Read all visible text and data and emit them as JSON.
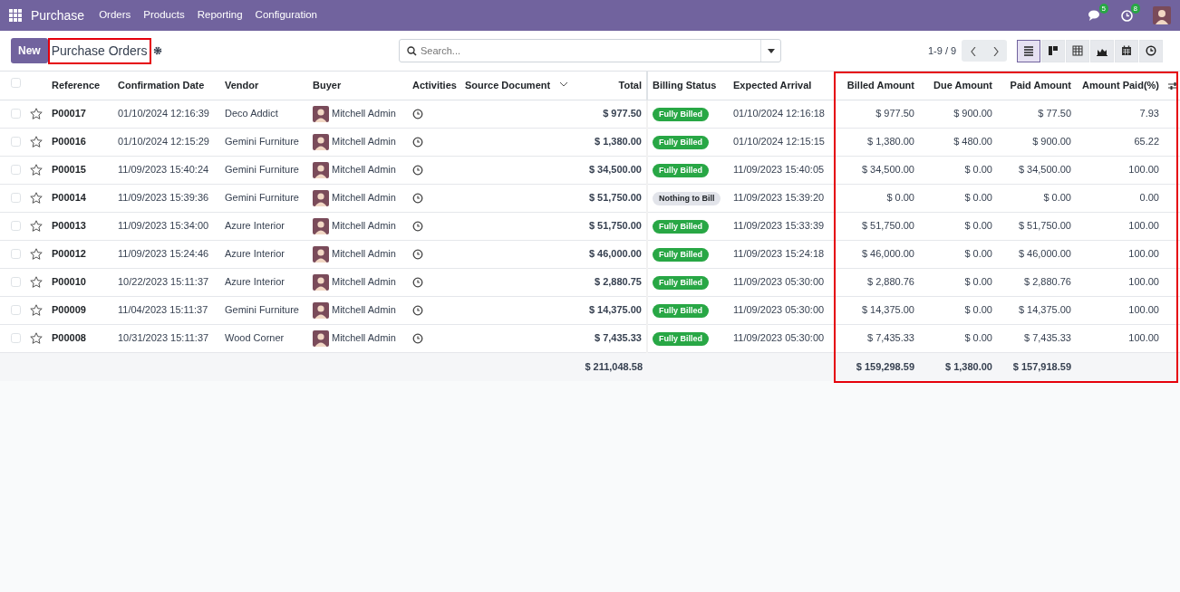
{
  "navbar": {
    "app": "Purchase",
    "menu": [
      "Orders",
      "Products",
      "Reporting",
      "Configuration"
    ],
    "messages_count": "5",
    "activities_count": "8"
  },
  "control_panel": {
    "new_button": "New",
    "title": "Purchase Orders",
    "title_highlighted": true,
    "search": {
      "placeholder": "Search..."
    },
    "pager": "1-9 / 9",
    "views": [
      {
        "kind": "list",
        "selected": true
      },
      {
        "kind": "kanban",
        "selected": false
      },
      {
        "kind": "pivot",
        "selected": false
      },
      {
        "kind": "graph",
        "selected": false
      },
      {
        "kind": "calendar",
        "selected": false
      },
      {
        "kind": "activity",
        "selected": false
      }
    ]
  },
  "table": {
    "all_checked": false,
    "amount_columns_highlighted": true,
    "columns": [
      "Reference",
      "Confirmation Date",
      "Vendor",
      "Buyer",
      "Activities",
      "Source Document",
      "Total",
      "Billing Status",
      "Expected Arrival",
      "Billed Amount",
      "Due Amount",
      "Paid Amount",
      "Amount Paid(%)"
    ],
    "rows": [
      {
        "checked": false,
        "starred": false,
        "reference": "P00017",
        "confirmation_date": "01/10/2024 12:16:39",
        "vendor": "Deco Addict",
        "buyer": "Mitchell Admin",
        "total": "$ 977.50",
        "billing_status": {
          "label": "Fully Billed",
          "kind": "fully"
        },
        "expected_arrival": "01/10/2024 12:16:18",
        "billed": "$ 977.50",
        "due": "$ 900.00",
        "paid": "$ 77.50",
        "paid_percent": "7.93"
      },
      {
        "checked": false,
        "starred": false,
        "reference": "P00016",
        "confirmation_date": "01/10/2024 12:15:29",
        "vendor": "Gemini Furniture",
        "buyer": "Mitchell Admin",
        "total": "$ 1,380.00",
        "billing_status": {
          "label": "Fully Billed",
          "kind": "fully"
        },
        "expected_arrival": "01/10/2024 12:15:15",
        "billed": "$ 1,380.00",
        "due": "$ 480.00",
        "paid": "$ 900.00",
        "paid_percent": "65.22"
      },
      {
        "checked": false,
        "starred": false,
        "reference": "P00015",
        "confirmation_date": "11/09/2023 15:40:24",
        "vendor": "Gemini Furniture",
        "buyer": "Mitchell Admin",
        "total": "$ 34,500.00",
        "billing_status": {
          "label": "Fully Billed",
          "kind": "fully"
        },
        "expected_arrival": "11/09/2023 15:40:05",
        "billed": "$ 34,500.00",
        "due": "$ 0.00",
        "paid": "$ 34,500.00",
        "paid_percent": "100.00"
      },
      {
        "checked": false,
        "starred": false,
        "reference": "P00014",
        "confirmation_date": "11/09/2023 15:39:36",
        "vendor": "Gemini Furniture",
        "buyer": "Mitchell Admin",
        "total": "$ 51,750.00",
        "billing_status": {
          "label": "Nothing to Bill",
          "kind": "nothing"
        },
        "expected_arrival": "11/09/2023 15:39:20",
        "billed": "$ 0.00",
        "due": "$ 0.00",
        "paid": "$ 0.00",
        "paid_percent": "0.00"
      },
      {
        "checked": false,
        "starred": false,
        "reference": "P00013",
        "confirmation_date": "11/09/2023 15:34:00",
        "vendor": "Azure Interior",
        "buyer": "Mitchell Admin",
        "total": "$ 51,750.00",
        "billing_status": {
          "label": "Fully Billed",
          "kind": "fully"
        },
        "expected_arrival": "11/09/2023 15:33:39",
        "billed": "$ 51,750.00",
        "due": "$ 0.00",
        "paid": "$ 51,750.00",
        "paid_percent": "100.00"
      },
      {
        "checked": false,
        "starred": false,
        "reference": "P00012",
        "confirmation_date": "11/09/2023 15:24:46",
        "vendor": "Azure Interior",
        "buyer": "Mitchell Admin",
        "total": "$ 46,000.00",
        "billing_status": {
          "label": "Fully Billed",
          "kind": "fully"
        },
        "expected_arrival": "11/09/2023 15:24:18",
        "billed": "$ 46,000.00",
        "due": "$ 0.00",
        "paid": "$ 46,000.00",
        "paid_percent": "100.00"
      },
      {
        "checked": false,
        "starred": false,
        "reference": "P00010",
        "confirmation_date": "10/22/2023 15:11:37",
        "vendor": "Azure Interior",
        "buyer": "Mitchell Admin",
        "total": "$ 2,880.75",
        "billing_status": {
          "label": "Fully Billed",
          "kind": "fully"
        },
        "expected_arrival": "11/09/2023 05:30:00",
        "billed": "$ 2,880.76",
        "due": "$ 0.00",
        "paid": "$ 2,880.76",
        "paid_percent": "100.00"
      },
      {
        "checked": false,
        "starred": false,
        "reference": "P00009",
        "confirmation_date": "11/04/2023 15:11:37",
        "vendor": "Gemini Furniture",
        "buyer": "Mitchell Admin",
        "total": "$ 14,375.00",
        "billing_status": {
          "label": "Fully Billed",
          "kind": "fully"
        },
        "expected_arrival": "11/09/2023 05:30:00",
        "billed": "$ 14,375.00",
        "due": "$ 0.00",
        "paid": "$ 14,375.00",
        "paid_percent": "100.00"
      },
      {
        "checked": false,
        "starred": false,
        "reference": "P00008",
        "confirmation_date": "10/31/2023 15:11:37",
        "vendor": "Wood Corner",
        "buyer": "Mitchell Admin",
        "total": "$ 7,435.33",
        "billing_status": {
          "label": "Fully Billed",
          "kind": "fully"
        },
        "expected_arrival": "11/09/2023 05:30:00",
        "billed": "$ 7,435.33",
        "due": "$ 0.00",
        "paid": "$ 7,435.33",
        "paid_percent": "100.00"
      }
    ],
    "totals": {
      "total": "$ 211,048.58",
      "billed": "$ 159,298.59",
      "due": "$ 1,380.00",
      "paid": "$ 157,918.59"
    }
  }
}
